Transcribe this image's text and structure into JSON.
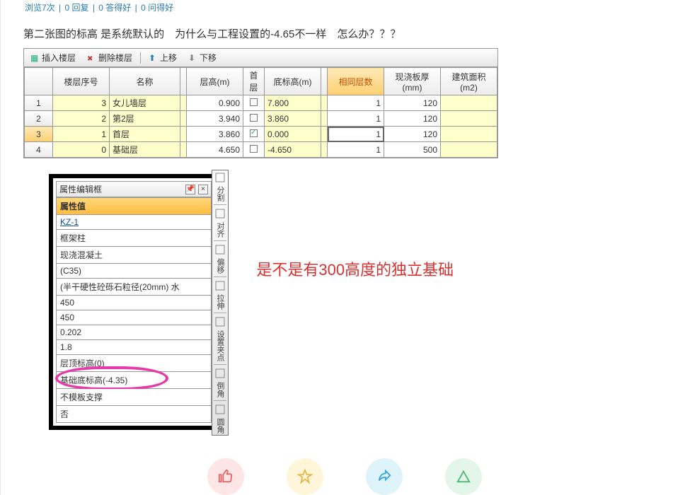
{
  "meta": {
    "views": "浏览7次",
    "replies": "0 回复",
    "answers": "0 答得好",
    "asks": "0 问得好"
  },
  "question": "第二张图的标高 是系统默认的　为什么与工程设置的-4.65不一样　怎么办？？？",
  "toolbar": {
    "insert": "插入楼层",
    "delete": "删除楼层",
    "up": "上移",
    "down": "下移"
  },
  "floor_headers": {
    "seq": "楼层序号",
    "name": "名称",
    "h": "层高(m)",
    "shou": "首层",
    "bot": "底标高(m)",
    "same": "相同层数",
    "thk": "现浇板厚(mm)",
    "area": "建筑面积(m2)"
  },
  "floors": [
    {
      "idx": "1",
      "seq": "3",
      "name": "女儿墙层",
      "h": "0.900",
      "shou": false,
      "bot": "7.800",
      "same": "1",
      "thk": "120",
      "area": ""
    },
    {
      "idx": "2",
      "seq": "2",
      "name": "第2层",
      "h": "3.940",
      "shou": false,
      "bot": "3.860",
      "same": "1",
      "thk": "120",
      "area": ""
    },
    {
      "idx": "3",
      "seq": "1",
      "name": "首层",
      "h": "3.860",
      "shou": true,
      "bot": "0.000",
      "same": "1",
      "thk": "120",
      "area": "",
      "sel": true,
      "active": true
    },
    {
      "idx": "4",
      "seq": "0",
      "name": "基础层",
      "h": "4.650",
      "shou": false,
      "bot": "-4.650",
      "same": "1",
      "thk": "500",
      "area": ""
    }
  ],
  "prop_panel": {
    "title": "属性编辑框",
    "head": "属性值",
    "rows": [
      {
        "t": "KZ-1",
        "link": true
      },
      {
        "t": "框架柱"
      },
      {
        "t": "现浇混凝土"
      },
      {
        "t": "(C35)"
      },
      {
        "t": "(半干硬性砼砾石粒径(20mm)  水"
      },
      {
        "t": "450"
      },
      {
        "t": "450"
      },
      {
        "t": "0.202"
      },
      {
        "t": "1.8"
      },
      {
        "t": "层顶标高(0)"
      },
      {
        "t": "基础底标高(-4.35)",
        "circle": true
      },
      {
        "t": "不模板支撑"
      },
      {
        "t": "否"
      }
    ]
  },
  "side_tools": [
    "分割",
    "对齐",
    "偏移",
    "拉伸",
    "设置夹点",
    "倒角",
    "圆角"
  ],
  "answer": "是不是有300高度的独立基础",
  "footer_icons": {
    "thumb": "thumb-up-icon",
    "star": "star-icon",
    "share": "share-icon",
    "tri": "triangle-icon"
  }
}
